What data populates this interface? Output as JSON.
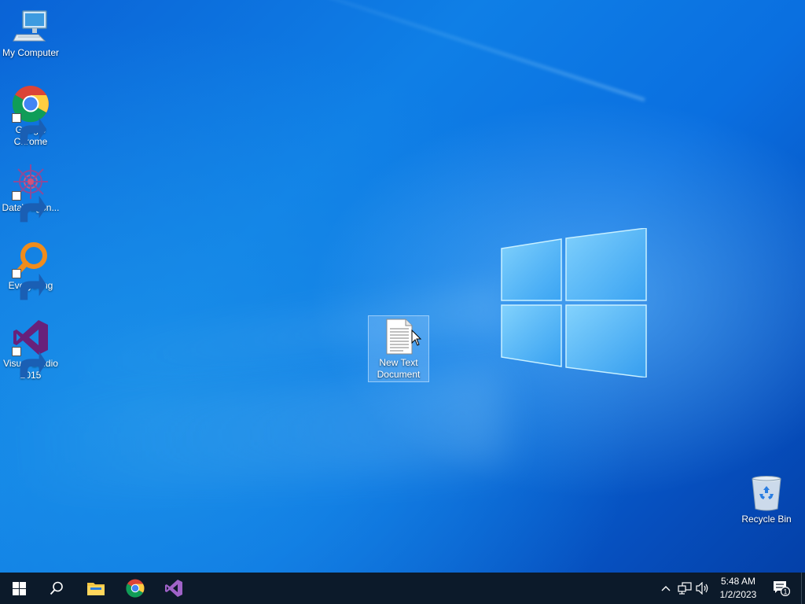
{
  "desktop": {
    "icons": [
      {
        "label": "My Computer",
        "icon": "computer-icon",
        "shortcut": false
      },
      {
        "label": "Google Chrome",
        "icon": "chrome-icon",
        "shortcut": true
      },
      {
        "label": "DataWagon...",
        "icon": "datawagon-icon",
        "shortcut": true
      },
      {
        "label": "Everything",
        "icon": "everything-search-icon",
        "shortcut": true
      },
      {
        "label": "Visual Studio 2015",
        "icon": "visual-studio-icon",
        "shortcut": true
      },
      {
        "label": "New Text Document",
        "icon": "text-document-icon",
        "shortcut": false,
        "selected": true
      },
      {
        "label": "Recycle Bin",
        "icon": "recycle-bin-icon",
        "shortcut": false
      }
    ]
  },
  "taskbar": {
    "start": {
      "icon": "windows-start-icon"
    },
    "search": {
      "icon": "search-icon"
    },
    "pinned": [
      {
        "name": "File Explorer",
        "icon": "folder-icon"
      },
      {
        "name": "Google Chrome",
        "icon": "chrome-icon"
      },
      {
        "name": "Visual Studio",
        "icon": "visual-studio-icon"
      }
    ],
    "tray": {
      "icons": [
        "chevron-up-icon",
        "network-icon",
        "volume-icon"
      ],
      "time": "5:48 AM",
      "date": "1/2/2023",
      "notification_count": "1"
    }
  },
  "colors": {
    "taskbar_bg": "#0c1a2a",
    "desktop_blue": "#0a6fe0",
    "vs_purple": "#68217a",
    "everything_orange": "#f08c1c"
  }
}
